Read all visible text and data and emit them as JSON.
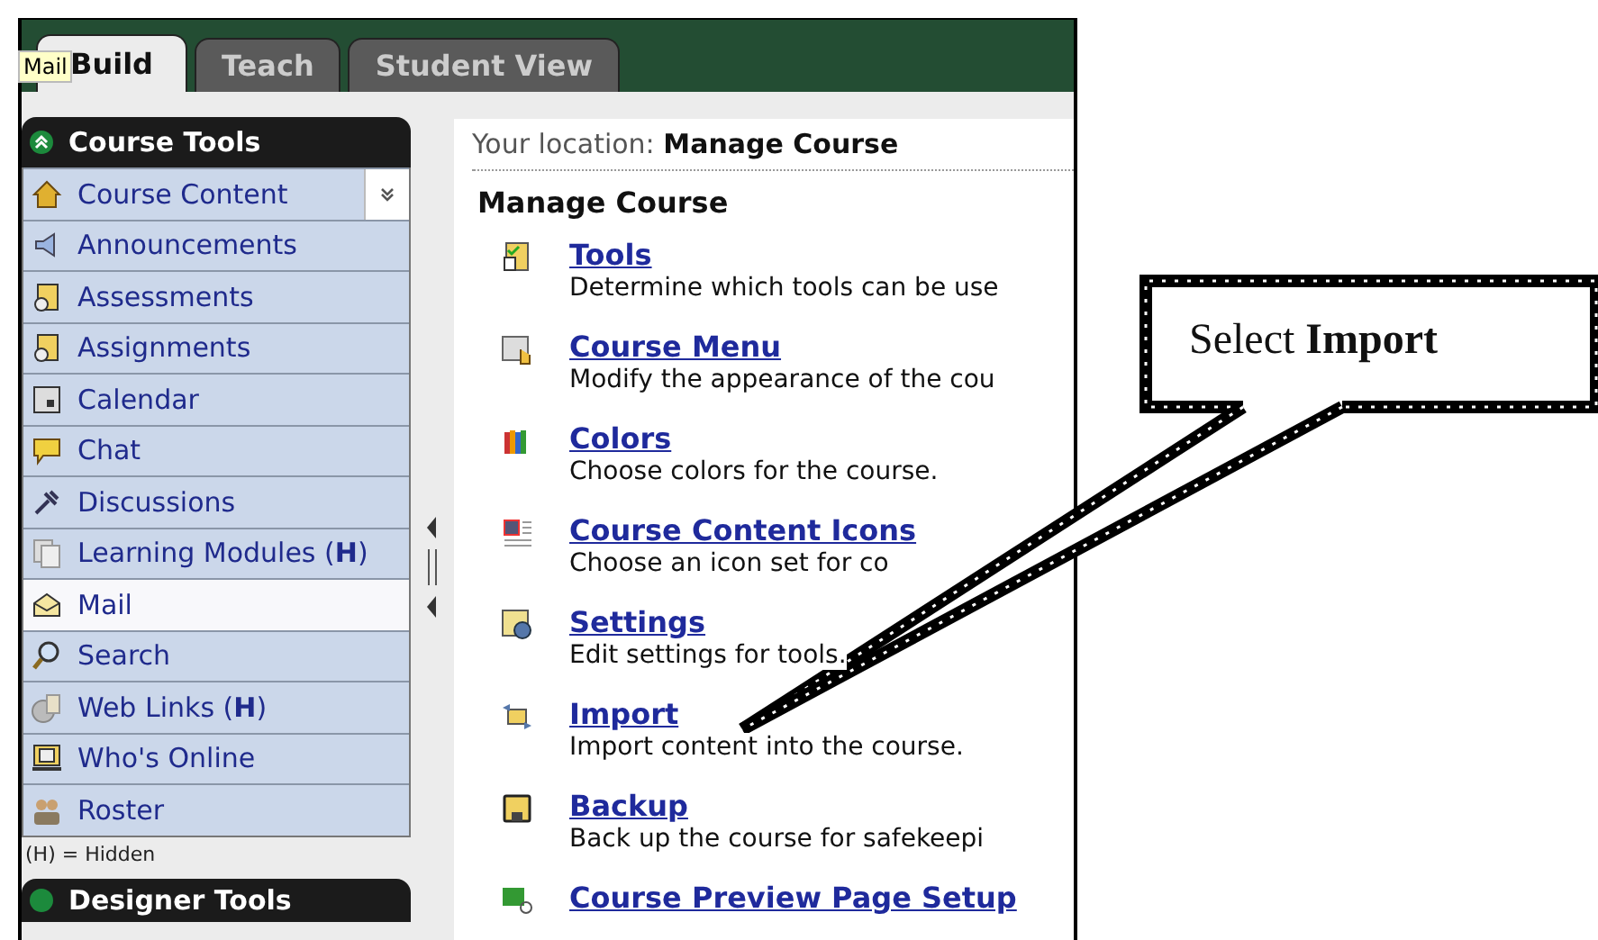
{
  "tabs": [
    {
      "label": "Build",
      "selected": true
    },
    {
      "label": "Teach",
      "selected": false
    },
    {
      "label": "Student View",
      "selected": false
    }
  ],
  "tooltip": "Mail",
  "sidebar": {
    "title": "Course Tools",
    "expanded": true,
    "items": [
      {
        "label": "Course Content",
        "selected": false,
        "dropdown": true
      },
      {
        "label": "Announcements",
        "selected": false
      },
      {
        "label": "Assessments",
        "selected": false
      },
      {
        "label": "Assignments",
        "selected": false
      },
      {
        "label": "Calendar",
        "selected": false
      },
      {
        "label": "Chat",
        "selected": false
      },
      {
        "label": "Discussions",
        "selected": false
      },
      {
        "label": "Learning Modules (**H**)",
        "selected": false
      },
      {
        "label": "Mail",
        "selected": true
      },
      {
        "label": "Search",
        "selected": false
      },
      {
        "label": "Web Links (**H**)",
        "selected": false
      },
      {
        "label": "Who's Online",
        "selected": false
      },
      {
        "label": "Roster",
        "selected": false
      }
    ],
    "legend": "(H) = Hidden",
    "next_section": "Designer Tools"
  },
  "breadcrumb": {
    "label": "Your location:",
    "value": "Manage Course"
  },
  "content": {
    "heading": "Manage Course",
    "items": [
      {
        "title": "Tools",
        "description": "Determine which tools can be use"
      },
      {
        "title": "Course Menu",
        "description": "Modify the appearance of the cou"
      },
      {
        "title": "Colors",
        "description": "Choose colors for the course."
      },
      {
        "title": "Course Content Icons",
        "description": "Choose an icon set for co"
      },
      {
        "title": "Settings",
        "description": "Edit settings for tools."
      },
      {
        "title": "Import",
        "description": "Import content into the course."
      },
      {
        "title": "Backup",
        "description": "Back up the course for safekeepi"
      },
      {
        "title": "Course Preview Page Setup"
      }
    ]
  },
  "callout": "Select **Import**"
}
